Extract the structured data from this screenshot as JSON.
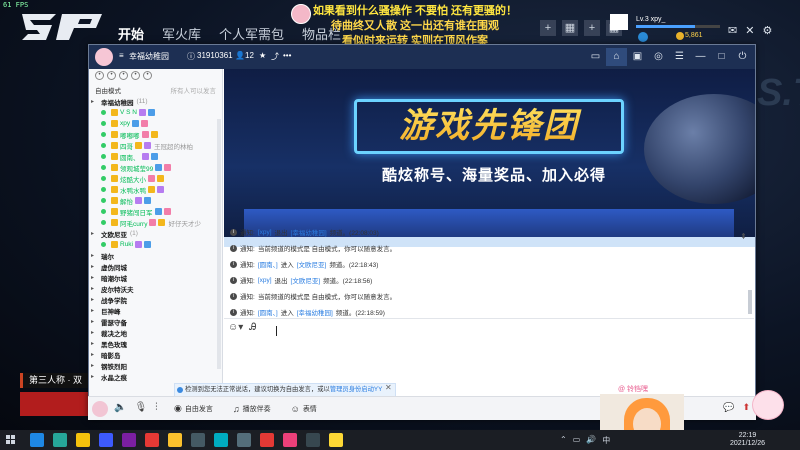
{
  "game": {
    "fps": "61 FPS",
    "nav": [
      "开始",
      "军火库",
      "个人军需包",
      "物品栏"
    ],
    "overlay": {
      "line1": "如果看到什么骚操作 不要怕 还有更骚的！",
      "line2": "待曲终又人散 这一出还有谁在围观",
      "line3": "看似时来运转 实则在顶风作案"
    },
    "user_name": "Lv.3 xpy_",
    "xp_fraction": 0.7,
    "gold": "5,861",
    "bg_text": "S.T",
    "mode_banner": "第三人称 · 双"
  },
  "yy": {
    "channel_name": "幸福幼稚园",
    "channel_id": "31910361",
    "online_count": "12",
    "sidebar": {
      "mode": "自由模式",
      "hint": "所有人可以发言",
      "rows": [
        {
          "type": "channel",
          "label": "幸福幼稚园",
          "extra": "(11)"
        },
        {
          "type": "user",
          "label": "V S N"
        },
        {
          "type": "user",
          "label": "xpy"
        },
        {
          "type": "user",
          "label": "嘟嘟嘟"
        },
        {
          "type": "user",
          "label": "四哥",
          "extra": "王冠超的林柏"
        },
        {
          "type": "user",
          "label": "圆南、"
        },
        {
          "type": "user",
          "label": "领观城莹99"
        },
        {
          "type": "user",
          "label": "炫酷大小"
        },
        {
          "type": "user",
          "label": "水鸭水鸭"
        },
        {
          "type": "user",
          "label": "解怡"
        },
        {
          "type": "user",
          "label": "野猪闯日军"
        },
        {
          "type": "user",
          "label": "阿毛curry",
          "extra": "好仔天才少"
        },
        {
          "type": "channel",
          "label": "文欧尼亚",
          "extra": "(1)"
        },
        {
          "type": "user",
          "label": "Ruki"
        },
        {
          "type": "channel",
          "label": "瑞尔"
        },
        {
          "type": "channel",
          "label": "虚伪同城"
        },
        {
          "type": "channel",
          "label": "暗潮尔城"
        },
        {
          "type": "channel",
          "label": "皮尔特沃夫"
        },
        {
          "type": "channel",
          "label": "战争学院"
        },
        {
          "type": "channel",
          "label": "巨神峰"
        },
        {
          "type": "channel",
          "label": "雷瑟守备"
        },
        {
          "type": "channel",
          "label": "裁决之地"
        },
        {
          "type": "channel",
          "label": "黑色玫瑰"
        },
        {
          "type": "channel",
          "label": "暗影岛"
        },
        {
          "type": "channel",
          "label": "钢铁烈阳"
        },
        {
          "type": "channel",
          "label": "水晶之痕"
        }
      ]
    },
    "banner": {
      "title": "游戏先锋团",
      "subtitle": "酷炫称号、海量奖品、加入必得"
    },
    "messages": [
      {
        "prefix": "通知:",
        "nick": "[xpy]",
        "action": "退出",
        "chan": "[幸福幼稚园]",
        "tail": "频道。(22:08:03)"
      },
      {
        "prefix": "通知:",
        "text": "当前频道的模式是 自由模式，你可以随意发言。"
      },
      {
        "prefix": "通知:",
        "nick": "[圆南、]",
        "action": "进入",
        "chan": "[文欧尼亚]",
        "tail": "频道。(22:18:43)"
      },
      {
        "prefix": "通知:",
        "nick": "[xpy]",
        "action": "退出",
        "chan": "[文欧尼亚]",
        "tail": "频道。(22:18:56)"
      },
      {
        "prefix": "通知:",
        "text": "当前频道的模式是 自由模式，你可以随意发言。"
      },
      {
        "prefix": "通知:",
        "nick": "[圆南、]",
        "action": "进入",
        "chan": "[幸福幼稚园]",
        "tail": "频道。(22:18:59)"
      }
    ],
    "notify_bar": {
      "text": "检测到您无法正常说话，建议切换为自由发言，或以",
      "link": "管理员身份启动YY"
    },
    "bottom": {
      "free_speech": "自由发言",
      "play_music": "播放伴奏",
      "emoji": "表情"
    },
    "webcam_nick": "@ 铃铛嘿"
  },
  "taskbar": {
    "time": "22:19",
    "date": "2021/12/26",
    "ime": "中"
  }
}
